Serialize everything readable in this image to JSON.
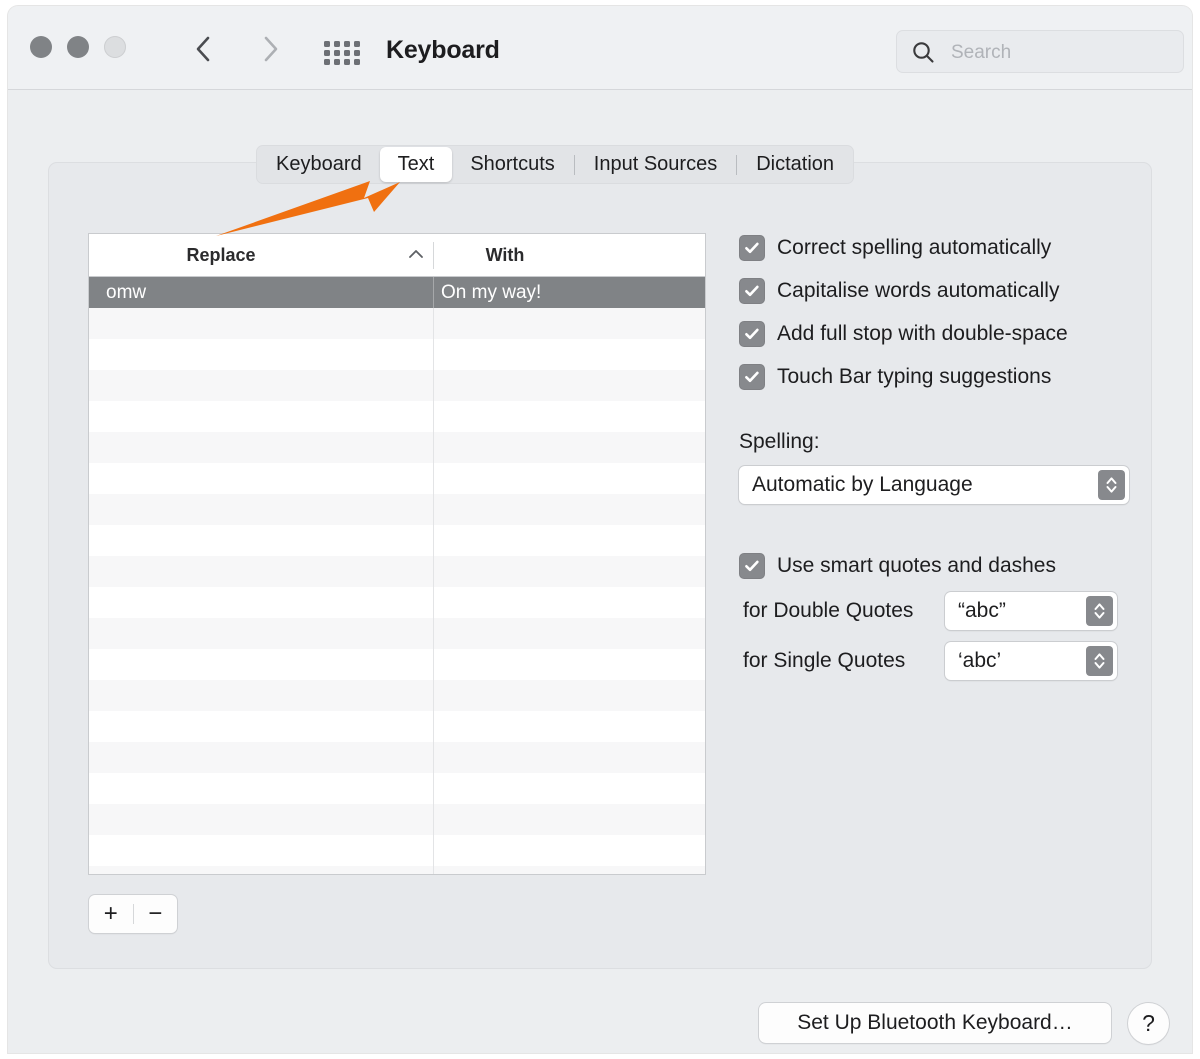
{
  "window": {
    "title": "Keyboard",
    "traffic_lights": [
      "close-disabled",
      "minimise-disabled",
      "zoom-disabled"
    ],
    "nav": {
      "back": "back-chevron",
      "forward": "forward-chevron",
      "show_all": "grid-icon"
    }
  },
  "search": {
    "placeholder": "Search",
    "value": "",
    "icon": "search-icon"
  },
  "tabs": [
    {
      "label": "Keyboard",
      "active": false,
      "separator_after": false
    },
    {
      "label": "Text",
      "active": true,
      "separator_after": false
    },
    {
      "label": "Shortcuts",
      "active": false,
      "separator_after": true
    },
    {
      "label": "Input Sources",
      "active": false,
      "separator_after": true
    },
    {
      "label": "Dictation",
      "active": false,
      "separator_after": false
    }
  ],
  "table": {
    "columns": [
      "Replace",
      "With"
    ],
    "sort_column": "Replace",
    "sort_direction": "ascending",
    "sort_icon": "chevron-up-icon",
    "rows": [
      {
        "replace": "omw",
        "with": "On my way!",
        "selected": true
      }
    ],
    "empty_row_count": 19
  },
  "list_controls": {
    "add_label": "+",
    "remove_label": "−"
  },
  "options": {
    "checkboxes": [
      {
        "label": "Correct spelling automatically",
        "checked": true
      },
      {
        "label": "Capitalise words automatically",
        "checked": true
      },
      {
        "label": "Add full stop with double-space",
        "checked": true
      },
      {
        "label": "Touch Bar typing suggestions",
        "checked": true
      }
    ],
    "spelling": {
      "label": "Spelling:",
      "value": "Automatic by Language"
    },
    "smart_quotes": {
      "checkbox_label": "Use smart quotes and dashes",
      "checked": true,
      "double": {
        "label": "for Double Quotes",
        "value": "“abc”"
      },
      "single": {
        "label": "for Single Quotes",
        "value": "‘abc’"
      }
    }
  },
  "footer": {
    "bluetooth_button": "Set Up Bluetooth Keyboard…",
    "help_button": "?"
  },
  "annotation": {
    "type": "arrow",
    "color": "#F07010",
    "points_to": "Text"
  },
  "colors": {
    "accent_annotation": "#F07010",
    "selection": "#808386",
    "window_bg": "#eceef0",
    "panel_bg": "#e7e9ec",
    "control_gray": "#87898d"
  }
}
